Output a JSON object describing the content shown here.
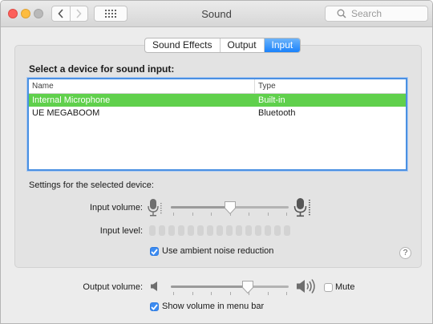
{
  "window": {
    "title": "Sound",
    "search_placeholder": "Search"
  },
  "tabs": [
    {
      "label": "Sound Effects",
      "active": false
    },
    {
      "label": "Output",
      "active": false
    },
    {
      "label": "Input",
      "active": true
    }
  ],
  "input_panel": {
    "heading": "Select a device for sound input:",
    "table": {
      "columns": [
        "Name",
        "Type"
      ],
      "rows": [
        {
          "name": "Internal Microphone",
          "type": "Built-in",
          "selected": true
        },
        {
          "name": "UE MEGABOOM",
          "type": "Bluetooth",
          "selected": false
        }
      ]
    },
    "settings_heading": "Settings for the selected device:",
    "input_volume_label": "Input volume:",
    "input_volume": 0.5,
    "input_level_label": "Input level:",
    "input_level_segments": 15,
    "input_level_active": 0,
    "ambient_noise": {
      "label": "Use ambient noise reduction",
      "checked": true
    },
    "help_label": "?"
  },
  "footer": {
    "output_volume_label": "Output volume:",
    "output_volume": 0.65,
    "mute": {
      "label": "Mute",
      "checked": false
    },
    "show_volume": {
      "label": "Show volume in menu bar",
      "checked": true
    }
  },
  "icons": {
    "mic_low": "microphone-low-icon",
    "mic_high": "microphone-high-icon",
    "speaker_low": "speaker-low-icon",
    "speaker_high": "speaker-high-icon",
    "search": "magnifier-icon",
    "grid": "grid-icon",
    "back": "chevron-left-icon",
    "forward": "chevron-right-icon",
    "checkmark": "checkmark-icon"
  },
  "colors": {
    "selected_row": "#60d04c",
    "accent": "#1a82fb",
    "focus_ring": "#4a90e2"
  }
}
